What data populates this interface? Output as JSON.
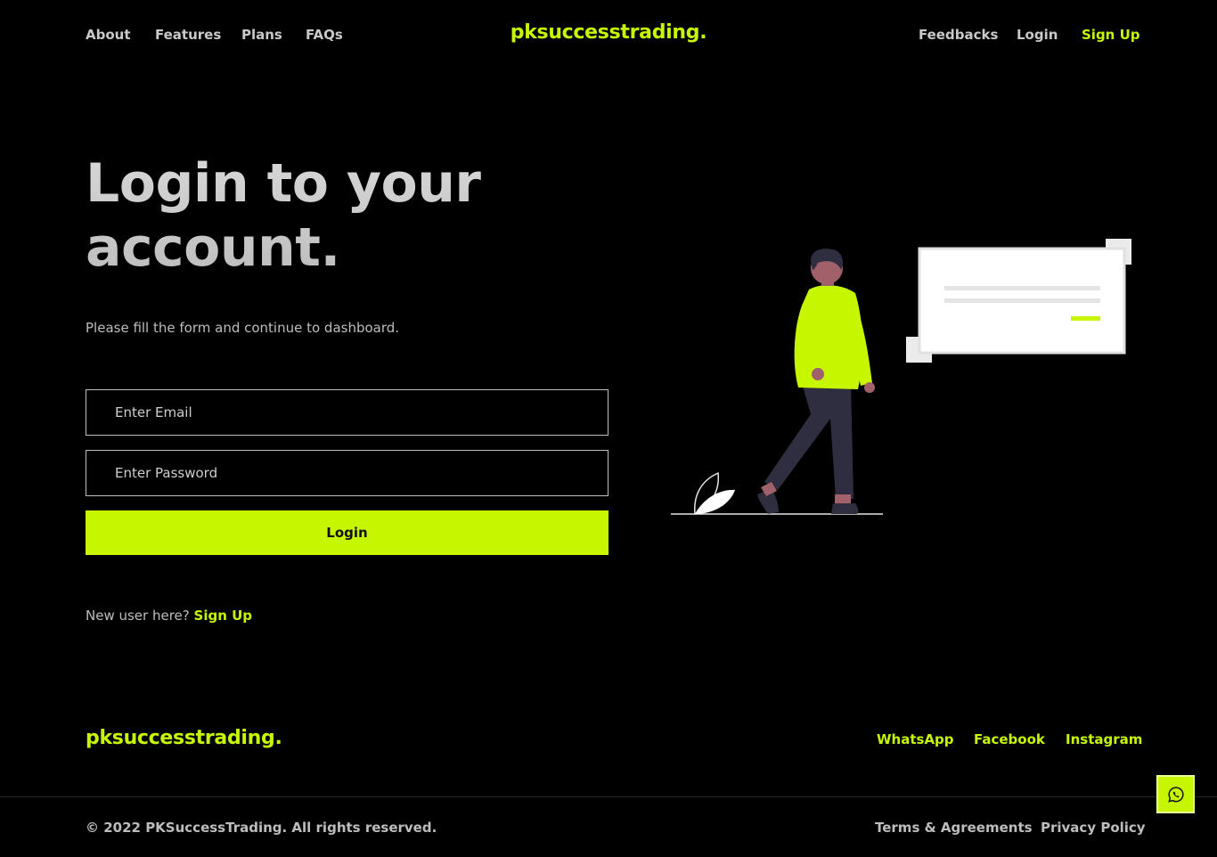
{
  "nav": {
    "left": [
      "About",
      "Features",
      "Plans",
      "FAQs"
    ],
    "brand": "pksuccesstrading.",
    "right": [
      "Feedbacks",
      "Login",
      "Sign Up"
    ]
  },
  "hero": {
    "title": "Login to your account.",
    "subtitle": "Please fill the form and continue to dashboard."
  },
  "form": {
    "email_placeholder": "Enter Email",
    "password_placeholder": "Enter Password",
    "login_label": "Login",
    "new_user_text": "New user here?",
    "signup_link": "Sign Up"
  },
  "footer": {
    "brand": "pksuccesstrading.",
    "social": [
      "WhatsApp",
      "Facebook",
      "Instagram"
    ],
    "copyright": "© 2022 PKSuccessTrading. All rights reserved.",
    "legal": [
      "Terms & Agreements",
      "Privacy Policy"
    ]
  },
  "icons": {
    "whatsapp_float": "whatsapp-icon"
  },
  "colors": {
    "accent": "#c6f600",
    "background": "#000000",
    "text": "#cfcfcf"
  }
}
